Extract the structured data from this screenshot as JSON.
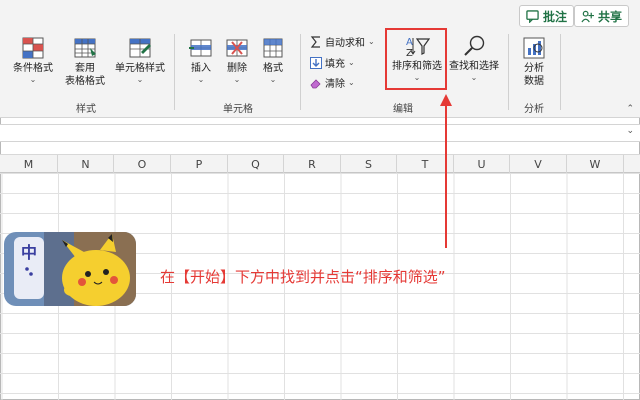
{
  "top_buttons": {
    "comment": "批注",
    "share": "共享"
  },
  "ribbon": {
    "styles": {
      "conditional_format": "条件格式",
      "format_table_line1": "套用",
      "format_table_line2": "表格格式",
      "cell_styles": "单元格样式",
      "label": "样式"
    },
    "cells": {
      "insert": "插入",
      "delete": "删除",
      "format": "格式",
      "label": "单元格"
    },
    "editing": {
      "autosum": "自动求和",
      "fill": "填充",
      "clear": "清除",
      "sort_filter": "排序和筛选",
      "find_select": "查找和选择",
      "label": "编辑"
    },
    "analysis": {
      "analyze_line1": "分析",
      "analyze_line2": "数据",
      "label": "分析"
    }
  },
  "columns": [
    "M",
    "N",
    "O",
    "P",
    "Q",
    "R",
    "S",
    "T",
    "U",
    "V",
    "W"
  ],
  "sticker": {
    "tag_char": "中"
  },
  "instruction": "在【开始】下方中找到并点击“排序和筛选”",
  "colors": {
    "accent_red": "#e53935",
    "excel_green": "#217346"
  }
}
